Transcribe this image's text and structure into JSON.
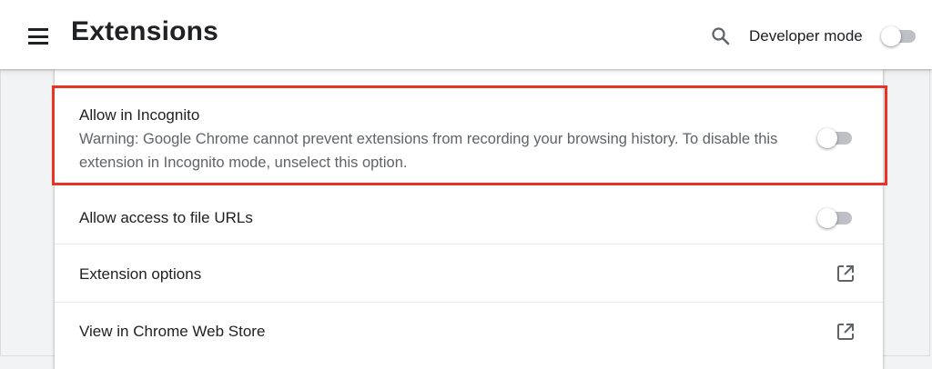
{
  "header": {
    "title": "Extensions",
    "developer_mode_label": "Developer mode",
    "developer_mode_on": false,
    "menu_icon": "hamburger-menu-icon",
    "search_icon": "search-icon"
  },
  "settings": [
    {
      "label": "Allow in Incognito",
      "description": "Warning: Google Chrome cannot prevent extensions from recording your browsing history. To disable this extension in Incognito mode, unselect this option.",
      "control": "toggle",
      "enabled": false,
      "highlighted": true
    },
    {
      "label": "Allow access to file URLs",
      "control": "toggle",
      "enabled": false
    },
    {
      "label": "Extension options",
      "control": "open-in-new-icon"
    },
    {
      "label": "View in Chrome Web Store",
      "control": "open-in-new-icon"
    }
  ],
  "colors": {
    "highlight_border": "#ea3323",
    "toggle_track_off": "#bdc1c6",
    "secondary_text": "#5f6368"
  }
}
